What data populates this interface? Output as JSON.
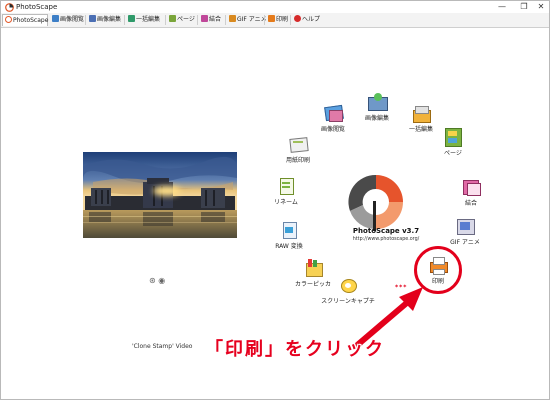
{
  "window": {
    "title": "PhotoScape",
    "minimize_glyph": "—",
    "close_glyph": "✕"
  },
  "tabs": [
    {
      "label": "PhotoScape",
      "active": true,
      "icon": "photoscape-logo-icon"
    },
    {
      "label": "画像閲覧",
      "icon": "viewer-icon"
    },
    {
      "label": "画像編集",
      "icon": "editor-icon"
    },
    {
      "label": "一括編集",
      "icon": "batch-icon"
    },
    {
      "label": "ページ",
      "icon": "page-icon"
    },
    {
      "label": "結合",
      "icon": "combine-icon"
    },
    {
      "label": "GIF アニメ",
      "icon": "gif-icon"
    },
    {
      "label": "印刷",
      "icon": "print-icon"
    },
    {
      "label": "ヘルプ",
      "icon": "help-icon"
    }
  ],
  "home": {
    "app_name": "PhotoScape v3.7",
    "url": "http://www.photoscape.org/",
    "caption": "'Clone Stamp' Video",
    "menu": {
      "viewer": "画像閲覧",
      "editor": "画像編集",
      "batch": "一括編集",
      "page": "ページ",
      "combine": "結合",
      "gif": "GIF アニメ",
      "print": "印刷",
      "screen_capture": "スクリーンキャプチ",
      "color_picker": "カラーピッカ",
      "raw": "RAW 変換",
      "rename": "リネーム",
      "paper_print": "用紙印刷"
    },
    "extra_text": "中",
    "stars": "***"
  },
  "annotation": {
    "instruction": "「印刷」をクリック",
    "color": "#e6001e"
  }
}
